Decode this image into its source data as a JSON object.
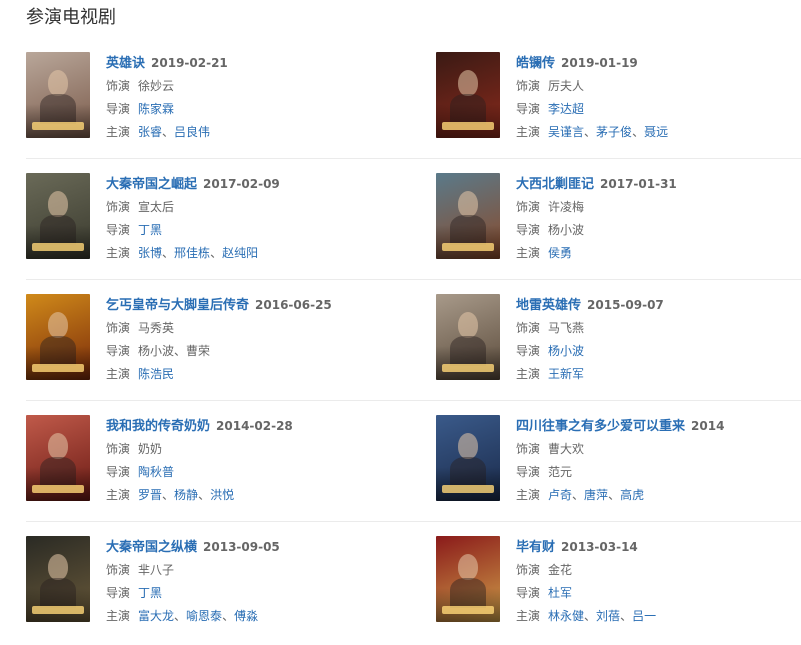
{
  "section_title": "参演电视剧",
  "labels": {
    "role": "饰演",
    "director": "导演",
    "starring": "主演"
  },
  "separator": "、",
  "colors": {
    "link": "#2a6eb4",
    "text": "#666666",
    "divider": "#ebebeb"
  },
  "shows": [
    {
      "title": "英雄诀",
      "date": "2019-02-21",
      "role": "徐妙云",
      "directors": [
        {
          "name": "陈家霖",
          "link": true
        }
      ],
      "stars": [
        {
          "name": "张睿",
          "link": true
        },
        {
          "name": "吕良伟",
          "link": true
        }
      ],
      "poster_colors": [
        "#b9a79a",
        "#7a5a4a"
      ]
    },
    {
      "title": "皓镧传",
      "date": "2019-01-19",
      "role": "厉夫人",
      "directors": [
        {
          "name": "李达超",
          "link": true
        }
      ],
      "stars": [
        {
          "name": "吴谨言",
          "link": true
        },
        {
          "name": "茅子俊",
          "link": true
        },
        {
          "name": "聂远",
          "link": true
        }
      ],
      "poster_colors": [
        "#3a1a14",
        "#8b2a1c"
      ]
    },
    {
      "title": "大秦帝国之崛起",
      "date": "2017-02-09",
      "role": "宣太后",
      "directors": [
        {
          "name": "丁黑",
          "link": true
        }
      ],
      "stars": [
        {
          "name": "张博",
          "link": true
        },
        {
          "name": "邢佳栋",
          "link": true
        },
        {
          "name": "赵纯阳",
          "link": true
        }
      ],
      "poster_colors": [
        "#6a6a58",
        "#3a3a2e"
      ]
    },
    {
      "title": "大西北剿匪记",
      "date": "2017-01-31",
      "role": "许凌梅",
      "directors": [
        {
          "name": "杨小波",
          "link": false
        }
      ],
      "stars": [
        {
          "name": "侯勇",
          "link": true
        }
      ],
      "poster_colors": [
        "#5a7a8a",
        "#8a4a2a"
      ]
    },
    {
      "title": "乞丐皇帝与大脚皇后传奇",
      "date": "2016-06-25",
      "role": "马秀英",
      "directors": [
        {
          "name": "杨小波",
          "link": false
        },
        {
          "name": "曹荣",
          "link": false
        }
      ],
      "stars": [
        {
          "name": "陈浩民",
          "link": true
        }
      ],
      "poster_colors": [
        "#d08a1a",
        "#7a2a0a"
      ]
    },
    {
      "title": "地雷英雄传",
      "date": "2015-09-07",
      "role": "马飞燕",
      "directors": [
        {
          "name": "杨小波",
          "link": true
        }
      ],
      "stars": [
        {
          "name": "王新军",
          "link": true
        }
      ],
      "poster_colors": [
        "#a89a8a",
        "#5a4a3a"
      ]
    },
    {
      "title": "我和我的传奇奶奶",
      "date": "2014-02-28",
      "role": "奶奶",
      "directors": [
        {
          "name": "陶秋普",
          "link": true
        }
      ],
      "stars": [
        {
          "name": "罗晋",
          "link": true
        },
        {
          "name": "杨静",
          "link": true
        },
        {
          "name": "洪悦",
          "link": true
        }
      ],
      "poster_colors": [
        "#c05a4a",
        "#6a1a14"
      ]
    },
    {
      "title": "四川往事之有多少爱可以重来",
      "date": "2014",
      "role": "曹大欢",
      "directors": [
        {
          "name": "范元",
          "link": false
        }
      ],
      "stars": [
        {
          "name": "卢奇",
          "link": true
        },
        {
          "name": "唐萍",
          "link": true
        },
        {
          "name": "高虎",
          "link": true
        }
      ],
      "poster_colors": [
        "#3a5a8a",
        "#1a2a4a"
      ]
    },
    {
      "title": "大秦帝国之纵横",
      "date": "2013-09-05",
      "role": "芈八子",
      "directors": [
        {
          "name": "丁黑",
          "link": true
        }
      ],
      "stars": [
        {
          "name": "富大龙",
          "link": true
        },
        {
          "name": "喻恩泰",
          "link": true
        },
        {
          "name": "傅淼",
          "link": true
        }
      ],
      "poster_colors": [
        "#2a2a24",
        "#6a5a3a"
      ]
    },
    {
      "title": "毕有财",
      "date": "2013-03-14",
      "role": "金花",
      "directors": [
        {
          "name": "杜军",
          "link": true
        }
      ],
      "stars": [
        {
          "name": "林永健",
          "link": true
        },
        {
          "name": "刘蓓",
          "link": true
        },
        {
          "name": "吕一",
          "link": true
        }
      ],
      "poster_colors": [
        "#8a1a1a",
        "#d0a04a"
      ]
    }
  ]
}
